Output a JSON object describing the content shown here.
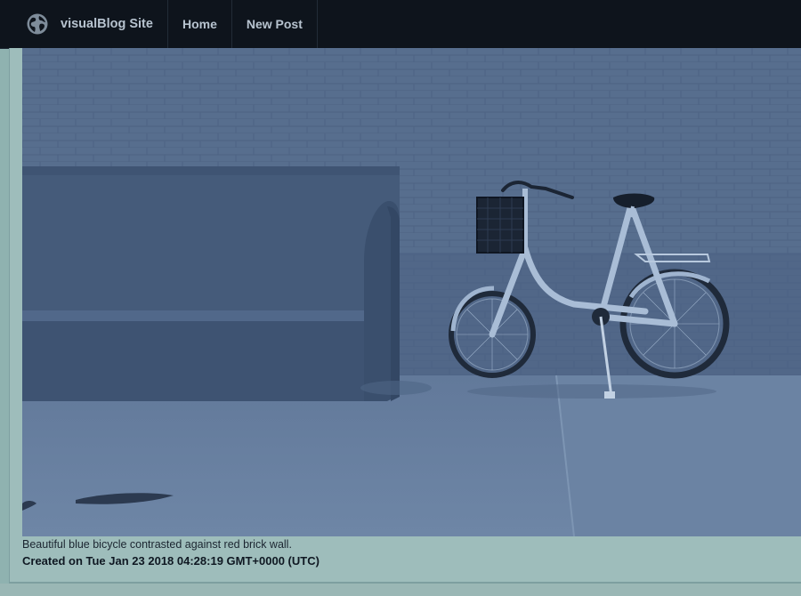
{
  "navbar": {
    "brand_label": "visualBlog Site",
    "brand_icon": "globe-icon",
    "links": [
      {
        "label": "Home"
      },
      {
        "label": "New Post"
      }
    ]
  },
  "post": {
    "image_subject": "bicycle-and-bench-photo",
    "caption": "Beautiful blue bicycle contrasted against red brick wall.",
    "created": "Created on Tue Jan 23 2018 04:28:19 GMT+0000 (UTC)"
  },
  "colors": {
    "navbar_bg": "#0e141c",
    "page_bg": "#8fb2b0",
    "card_bg": "#9ebdbb",
    "nav_text": "#b7c3cf",
    "photo_tint": "#4a6180"
  }
}
